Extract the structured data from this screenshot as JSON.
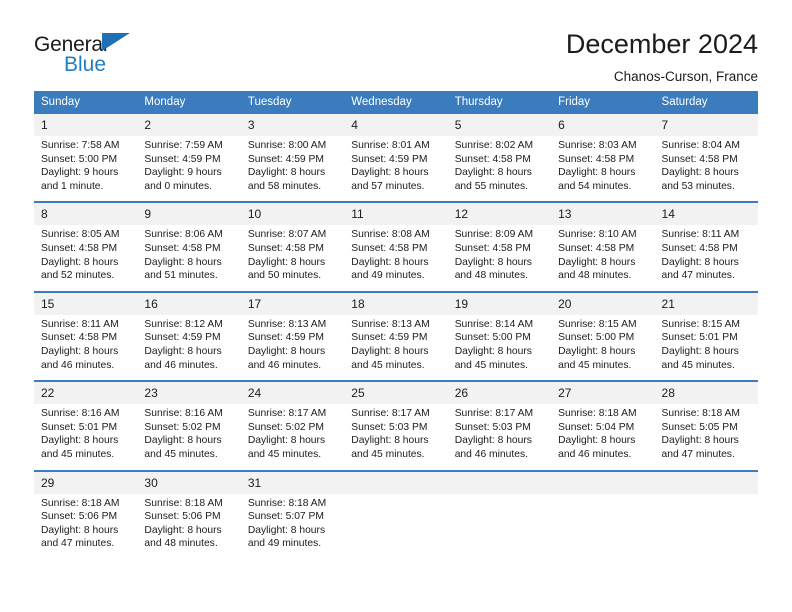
{
  "brand": {
    "line1": "General",
    "line2": "Blue",
    "triangle_color": "#1f6fb5",
    "line2_color": "#1f7fc4"
  },
  "header": {
    "title": "December 2024",
    "location": "Chanos-Curson, France"
  },
  "theme": {
    "header_blue": "#3a7cbe",
    "daynum_bg": "#f2f2f2",
    "text": "#1c1c1c"
  },
  "weekday_headers": [
    "Sunday",
    "Monday",
    "Tuesday",
    "Wednesday",
    "Thursday",
    "Friday",
    "Saturday"
  ],
  "labels": {
    "sunrise_prefix": "Sunrise:",
    "sunset_prefix": "Sunset:",
    "daylight_prefix": "Daylight:"
  },
  "weeks": [
    [
      {
        "day": "1",
        "sunrise": "Sunrise: 7:58 AM",
        "sunset": "Sunset: 5:00 PM",
        "daylight1": "Daylight: 9 hours",
        "daylight2": "and 1 minute."
      },
      {
        "day": "2",
        "sunrise": "Sunrise: 7:59 AM",
        "sunset": "Sunset: 4:59 PM",
        "daylight1": "Daylight: 9 hours",
        "daylight2": "and 0 minutes."
      },
      {
        "day": "3",
        "sunrise": "Sunrise: 8:00 AM",
        "sunset": "Sunset: 4:59 PM",
        "daylight1": "Daylight: 8 hours",
        "daylight2": "and 58 minutes."
      },
      {
        "day": "4",
        "sunrise": "Sunrise: 8:01 AM",
        "sunset": "Sunset: 4:59 PM",
        "daylight1": "Daylight: 8 hours",
        "daylight2": "and 57 minutes."
      },
      {
        "day": "5",
        "sunrise": "Sunrise: 8:02 AM",
        "sunset": "Sunset: 4:58 PM",
        "daylight1": "Daylight: 8 hours",
        "daylight2": "and 55 minutes."
      },
      {
        "day": "6",
        "sunrise": "Sunrise: 8:03 AM",
        "sunset": "Sunset: 4:58 PM",
        "daylight1": "Daylight: 8 hours",
        "daylight2": "and 54 minutes."
      },
      {
        "day": "7",
        "sunrise": "Sunrise: 8:04 AM",
        "sunset": "Sunset: 4:58 PM",
        "daylight1": "Daylight: 8 hours",
        "daylight2": "and 53 minutes."
      }
    ],
    [
      {
        "day": "8",
        "sunrise": "Sunrise: 8:05 AM",
        "sunset": "Sunset: 4:58 PM",
        "daylight1": "Daylight: 8 hours",
        "daylight2": "and 52 minutes."
      },
      {
        "day": "9",
        "sunrise": "Sunrise: 8:06 AM",
        "sunset": "Sunset: 4:58 PM",
        "daylight1": "Daylight: 8 hours",
        "daylight2": "and 51 minutes."
      },
      {
        "day": "10",
        "sunrise": "Sunrise: 8:07 AM",
        "sunset": "Sunset: 4:58 PM",
        "daylight1": "Daylight: 8 hours",
        "daylight2": "and 50 minutes."
      },
      {
        "day": "11",
        "sunrise": "Sunrise: 8:08 AM",
        "sunset": "Sunset: 4:58 PM",
        "daylight1": "Daylight: 8 hours",
        "daylight2": "and 49 minutes."
      },
      {
        "day": "12",
        "sunrise": "Sunrise: 8:09 AM",
        "sunset": "Sunset: 4:58 PM",
        "daylight1": "Daylight: 8 hours",
        "daylight2": "and 48 minutes."
      },
      {
        "day": "13",
        "sunrise": "Sunrise: 8:10 AM",
        "sunset": "Sunset: 4:58 PM",
        "daylight1": "Daylight: 8 hours",
        "daylight2": "and 48 minutes."
      },
      {
        "day": "14",
        "sunrise": "Sunrise: 8:11 AM",
        "sunset": "Sunset: 4:58 PM",
        "daylight1": "Daylight: 8 hours",
        "daylight2": "and 47 minutes."
      }
    ],
    [
      {
        "day": "15",
        "sunrise": "Sunrise: 8:11 AM",
        "sunset": "Sunset: 4:58 PM",
        "daylight1": "Daylight: 8 hours",
        "daylight2": "and 46 minutes."
      },
      {
        "day": "16",
        "sunrise": "Sunrise: 8:12 AM",
        "sunset": "Sunset: 4:59 PM",
        "daylight1": "Daylight: 8 hours",
        "daylight2": "and 46 minutes."
      },
      {
        "day": "17",
        "sunrise": "Sunrise: 8:13 AM",
        "sunset": "Sunset: 4:59 PM",
        "daylight1": "Daylight: 8 hours",
        "daylight2": "and 46 minutes."
      },
      {
        "day": "18",
        "sunrise": "Sunrise: 8:13 AM",
        "sunset": "Sunset: 4:59 PM",
        "daylight1": "Daylight: 8 hours",
        "daylight2": "and 45 minutes."
      },
      {
        "day": "19",
        "sunrise": "Sunrise: 8:14 AM",
        "sunset": "Sunset: 5:00 PM",
        "daylight1": "Daylight: 8 hours",
        "daylight2": "and 45 minutes."
      },
      {
        "day": "20",
        "sunrise": "Sunrise: 8:15 AM",
        "sunset": "Sunset: 5:00 PM",
        "daylight1": "Daylight: 8 hours",
        "daylight2": "and 45 minutes."
      },
      {
        "day": "21",
        "sunrise": "Sunrise: 8:15 AM",
        "sunset": "Sunset: 5:01 PM",
        "daylight1": "Daylight: 8 hours",
        "daylight2": "and 45 minutes."
      }
    ],
    [
      {
        "day": "22",
        "sunrise": "Sunrise: 8:16 AM",
        "sunset": "Sunset: 5:01 PM",
        "daylight1": "Daylight: 8 hours",
        "daylight2": "and 45 minutes."
      },
      {
        "day": "23",
        "sunrise": "Sunrise: 8:16 AM",
        "sunset": "Sunset: 5:02 PM",
        "daylight1": "Daylight: 8 hours",
        "daylight2": "and 45 minutes."
      },
      {
        "day": "24",
        "sunrise": "Sunrise: 8:17 AM",
        "sunset": "Sunset: 5:02 PM",
        "daylight1": "Daylight: 8 hours",
        "daylight2": "and 45 minutes."
      },
      {
        "day": "25",
        "sunrise": "Sunrise: 8:17 AM",
        "sunset": "Sunset: 5:03 PM",
        "daylight1": "Daylight: 8 hours",
        "daylight2": "and 45 minutes."
      },
      {
        "day": "26",
        "sunrise": "Sunrise: 8:17 AM",
        "sunset": "Sunset: 5:03 PM",
        "daylight1": "Daylight: 8 hours",
        "daylight2": "and 46 minutes."
      },
      {
        "day": "27",
        "sunrise": "Sunrise: 8:18 AM",
        "sunset": "Sunset: 5:04 PM",
        "daylight1": "Daylight: 8 hours",
        "daylight2": "and 46 minutes."
      },
      {
        "day": "28",
        "sunrise": "Sunrise: 8:18 AM",
        "sunset": "Sunset: 5:05 PM",
        "daylight1": "Daylight: 8 hours",
        "daylight2": "and 47 minutes."
      }
    ],
    [
      {
        "day": "29",
        "sunrise": "Sunrise: 8:18 AM",
        "sunset": "Sunset: 5:06 PM",
        "daylight1": "Daylight: 8 hours",
        "daylight2": "and 47 minutes."
      },
      {
        "day": "30",
        "sunrise": "Sunrise: 8:18 AM",
        "sunset": "Sunset: 5:06 PM",
        "daylight1": "Daylight: 8 hours",
        "daylight2": "and 48 minutes."
      },
      {
        "day": "31",
        "sunrise": "Sunrise: 8:18 AM",
        "sunset": "Sunset: 5:07 PM",
        "daylight1": "Daylight: 8 hours",
        "daylight2": "and 49 minutes."
      },
      {
        "day": "",
        "sunrise": "",
        "sunset": "",
        "daylight1": "",
        "daylight2": ""
      },
      {
        "day": "",
        "sunrise": "",
        "sunset": "",
        "daylight1": "",
        "daylight2": ""
      },
      {
        "day": "",
        "sunrise": "",
        "sunset": "",
        "daylight1": "",
        "daylight2": ""
      },
      {
        "day": "",
        "sunrise": "",
        "sunset": "",
        "daylight1": "",
        "daylight2": ""
      }
    ]
  ]
}
